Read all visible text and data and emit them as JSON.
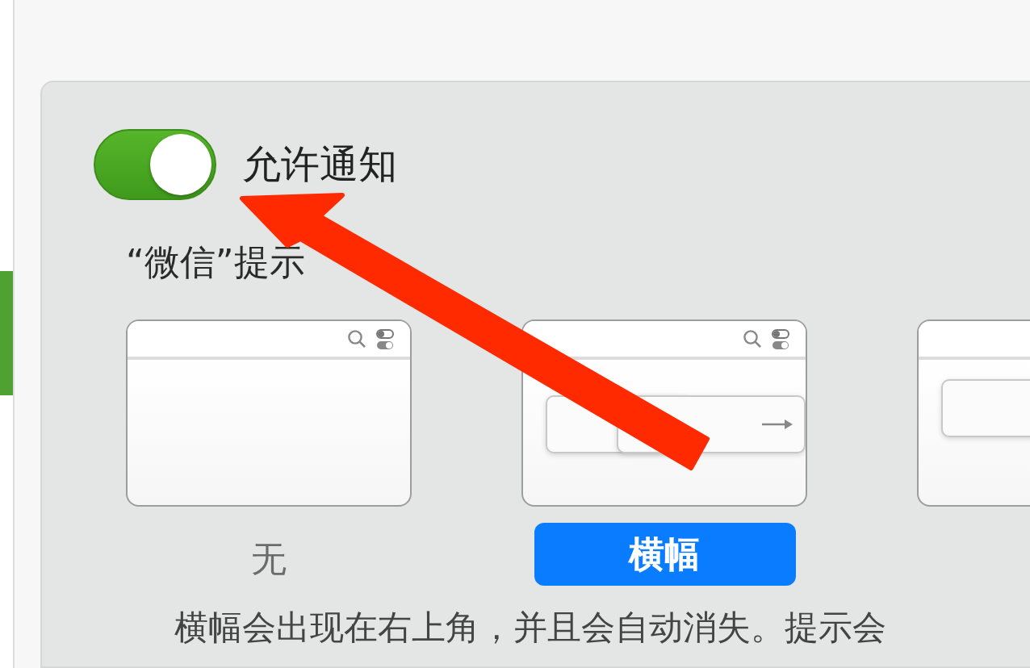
{
  "sidebar": {
    "items": [
      {
        "selected": true
      }
    ]
  },
  "notifications": {
    "label": "允许通知",
    "on": true
  },
  "style_heading": "“微信”提示",
  "styles": [
    {
      "kind": "none",
      "label": "无",
      "selected": false
    },
    {
      "kind": "banner",
      "label": "横幅",
      "selected": true
    },
    {
      "kind": "alert",
      "selected": false
    }
  ],
  "description": "横幅会出现在右上角，并且会自动消失。提示会"
}
